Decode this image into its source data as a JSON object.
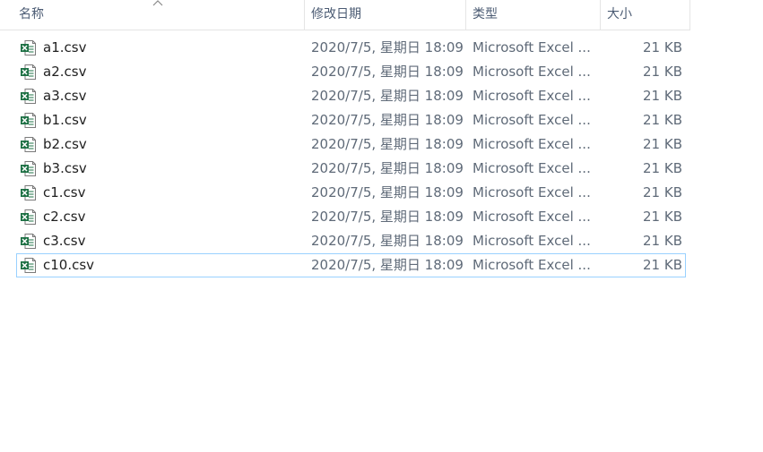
{
  "header": {
    "columns": {
      "name": "名称",
      "date": "修改日期",
      "type": "类型",
      "size": "大小"
    }
  },
  "files": [
    {
      "name": "a1.csv",
      "date": "2020/7/5, 星期日 18:09",
      "type": "Microsoft Excel ...",
      "size": "21 KB"
    },
    {
      "name": "a2.csv",
      "date": "2020/7/5, 星期日 18:09",
      "type": "Microsoft Excel ...",
      "size": "21 KB"
    },
    {
      "name": "a3.csv",
      "date": "2020/7/5, 星期日 18:09",
      "type": "Microsoft Excel ...",
      "size": "21 KB"
    },
    {
      "name": "b1.csv",
      "date": "2020/7/5, 星期日 18:09",
      "type": "Microsoft Excel ...",
      "size": "21 KB"
    },
    {
      "name": "b2.csv",
      "date": "2020/7/5, 星期日 18:09",
      "type": "Microsoft Excel ...",
      "size": "21 KB"
    },
    {
      "name": "b3.csv",
      "date": "2020/7/5, 星期日 18:09",
      "type": "Microsoft Excel ...",
      "size": "21 KB"
    },
    {
      "name": "c1.csv",
      "date": "2020/7/5, 星期日 18:09",
      "type": "Microsoft Excel ...",
      "size": "21 KB"
    },
    {
      "name": "c2.csv",
      "date": "2020/7/5, 星期日 18:09",
      "type": "Microsoft Excel ...",
      "size": "21 KB"
    },
    {
      "name": "c3.csv",
      "date": "2020/7/5, 星期日 18:09",
      "type": "Microsoft Excel ...",
      "size": "21 KB"
    },
    {
      "name": "c10.csv",
      "date": "2020/7/5, 星期日 18:09",
      "type": "Microsoft Excel ...",
      "size": "21 KB"
    }
  ],
  "focused_index": 9,
  "icons": {
    "file": "excel-csv-file-icon",
    "sort": "sort-ascending-icon"
  },
  "colors": {
    "header_text": "#4b5b73",
    "detail_text": "#5f6a78",
    "focus_border": "#99d1ff",
    "excel_green": "#1e7145"
  }
}
